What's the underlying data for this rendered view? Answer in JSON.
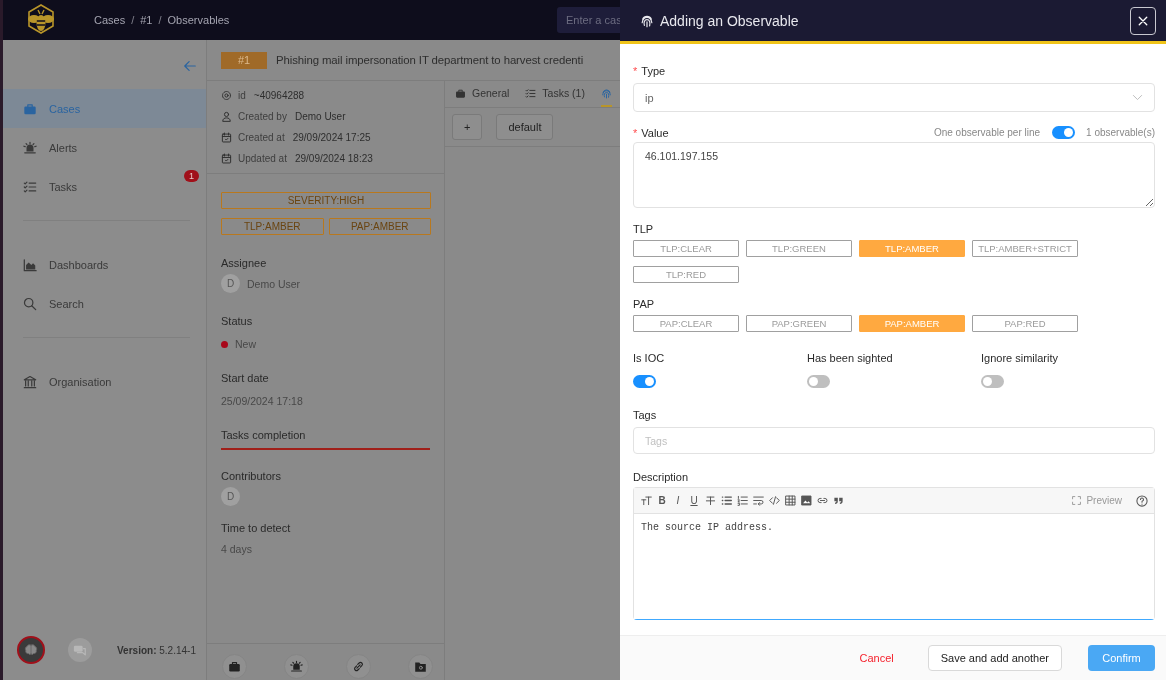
{
  "topbar": {
    "breadcrumbs": [
      {
        "kind": "crumb",
        "text": "Cases"
      },
      {
        "kind": "separator",
        "text": "/"
      },
      {
        "kind": "crumb",
        "text": "#1"
      },
      {
        "kind": "separator",
        "text": "/"
      },
      {
        "kind": "crumb",
        "text": "Observables"
      }
    ],
    "search": {
      "placeholder": "Enter a cas"
    }
  },
  "sidebar": {
    "sections": [
      {
        "items": [
          {
            "label": "Cases",
            "selected": true
          },
          {
            "label": "Alerts",
            "selected": false
          },
          {
            "label": "Tasks",
            "selected": false,
            "badge": "1"
          }
        ]
      },
      {
        "items": [
          {
            "label": "Dashboards",
            "selected": false
          },
          {
            "label": "Search",
            "selected": false
          }
        ]
      },
      {
        "items": [
          {
            "label": "Organisation",
            "selected": false
          }
        ]
      }
    ],
    "version": "**Version:** 5.2.14-1"
  },
  "case": {
    "number": "#1",
    "title": "Phishing mail impersonation IT department to harvest credenti",
    "meta": [
      {
        "label": "id",
        "value": "~40964288"
      },
      {
        "label": "Created by",
        "value": "Demo User"
      },
      {
        "label": "Created at",
        "value": "29/09/2024 17:25"
      },
      {
        "label": "Updated at",
        "value": "29/09/2024 18:23"
      }
    ],
    "severity": "SEVERITY:HIGH",
    "tlp": "TLP:AMBER",
    "pap": "PAP:AMBER",
    "assignee": {
      "label": "Assignee",
      "initial": "D",
      "name": "Demo User"
    },
    "status": {
      "label": "Status",
      "value": "New",
      "color": "#a8071a"
    },
    "start_date": {
      "label": "Start date",
      "value": "25/09/2024 17:18"
    },
    "tasks_completion": {
      "label": "Tasks completion",
      "level": 1
    },
    "contributors": {
      "label": "Contributors",
      "initials": [
        "D"
      ]
    },
    "time_to_detect": {
      "label": "Time to detect",
      "value": "4 days"
    }
  },
  "tabs": [
    {
      "label": "General",
      "selected": false
    },
    {
      "label": "Tasks (1)",
      "selected": false
    },
    {
      "selected": true
    }
  ],
  "toolbar": {
    "add": "+",
    "filter": "default"
  },
  "drawer": {
    "title": "Adding an Observable",
    "type": {
      "label": "Type",
      "required_mark": "*",
      "value": "ip"
    },
    "value": {
      "label": "Value",
      "required_mark": "*",
      "per_line_label": "One observable per line",
      "per_line_on": true,
      "count": "1 observable(s)",
      "text": "46.101.197.155"
    },
    "tlp": {
      "label": "TLP",
      "options": [
        {
          "label": "TLP:CLEAR",
          "selected": false
        },
        {
          "label": "TLP:GREEN",
          "selected": false
        },
        {
          "label": "TLP:AMBER",
          "selected": true
        },
        {
          "label": "TLP:AMBER+STRICT",
          "selected": false
        },
        {
          "label": "TLP:RED",
          "selected": false
        }
      ]
    },
    "pap": {
      "label": "PAP",
      "options": [
        {
          "label": "PAP:CLEAR",
          "selected": false
        },
        {
          "label": "PAP:GREEN",
          "selected": false
        },
        {
          "label": "PAP:AMBER",
          "selected": true
        },
        {
          "label": "PAP:RED",
          "selected": false
        }
      ]
    },
    "switches": [
      {
        "label": "Is IOC",
        "on": true
      },
      {
        "label": "Has been sighted",
        "on": false
      },
      {
        "label": "Ignore similarity",
        "on": false
      }
    ],
    "tags": {
      "label": "Tags",
      "placeholder": "Tags"
    },
    "description": {
      "label": "Description",
      "tools": [
        {
          "kind": "heading"
        },
        {
          "kind": "bold",
          "glyph": "B"
        },
        {
          "kind": "italic",
          "glyph": "I"
        },
        {
          "kind": "underline",
          "glyph": "U"
        },
        {
          "kind": "strike"
        },
        {
          "kind": "bullets"
        },
        {
          "kind": "numbers"
        },
        {
          "kind": "wrap"
        },
        {
          "kind": "code"
        },
        {
          "kind": "table"
        },
        {
          "kind": "image"
        },
        {
          "kind": "link"
        },
        {
          "kind": "quote"
        }
      ],
      "preview": "Preview",
      "text": "The source IP address."
    },
    "buttons": [
      {
        "kind": "cancel",
        "label": "Cancel"
      },
      {
        "kind": "secondary",
        "label": "Save and add another"
      },
      {
        "kind": "primary",
        "label": "Confirm"
      }
    ]
  }
}
